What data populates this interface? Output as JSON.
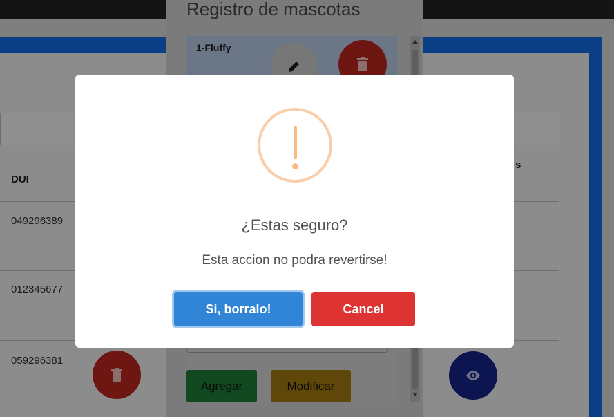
{
  "background": {
    "table": {
      "headers": {
        "dui": "DUI",
        "partial": "s"
      },
      "rows": [
        {
          "dui": "049296389"
        },
        {
          "dui": "012345677"
        },
        {
          "dui": "059296381"
        }
      ]
    }
  },
  "pet_modal": {
    "title": "Registro de mascotas",
    "items": [
      {
        "label": "1-Fluffy"
      }
    ],
    "buttons": {
      "add": "Agregar",
      "modify": "Modificar"
    }
  },
  "alert": {
    "icon": "warning-icon",
    "title": "¿Estas seguro?",
    "text": "Esta accion no podra revertirse!",
    "confirm_label": "Si, borralo!",
    "cancel_label": "Cancel"
  },
  "colors": {
    "confirm": "#3085d6",
    "cancel": "#dd3333",
    "warning": "#f8bb86"
  }
}
